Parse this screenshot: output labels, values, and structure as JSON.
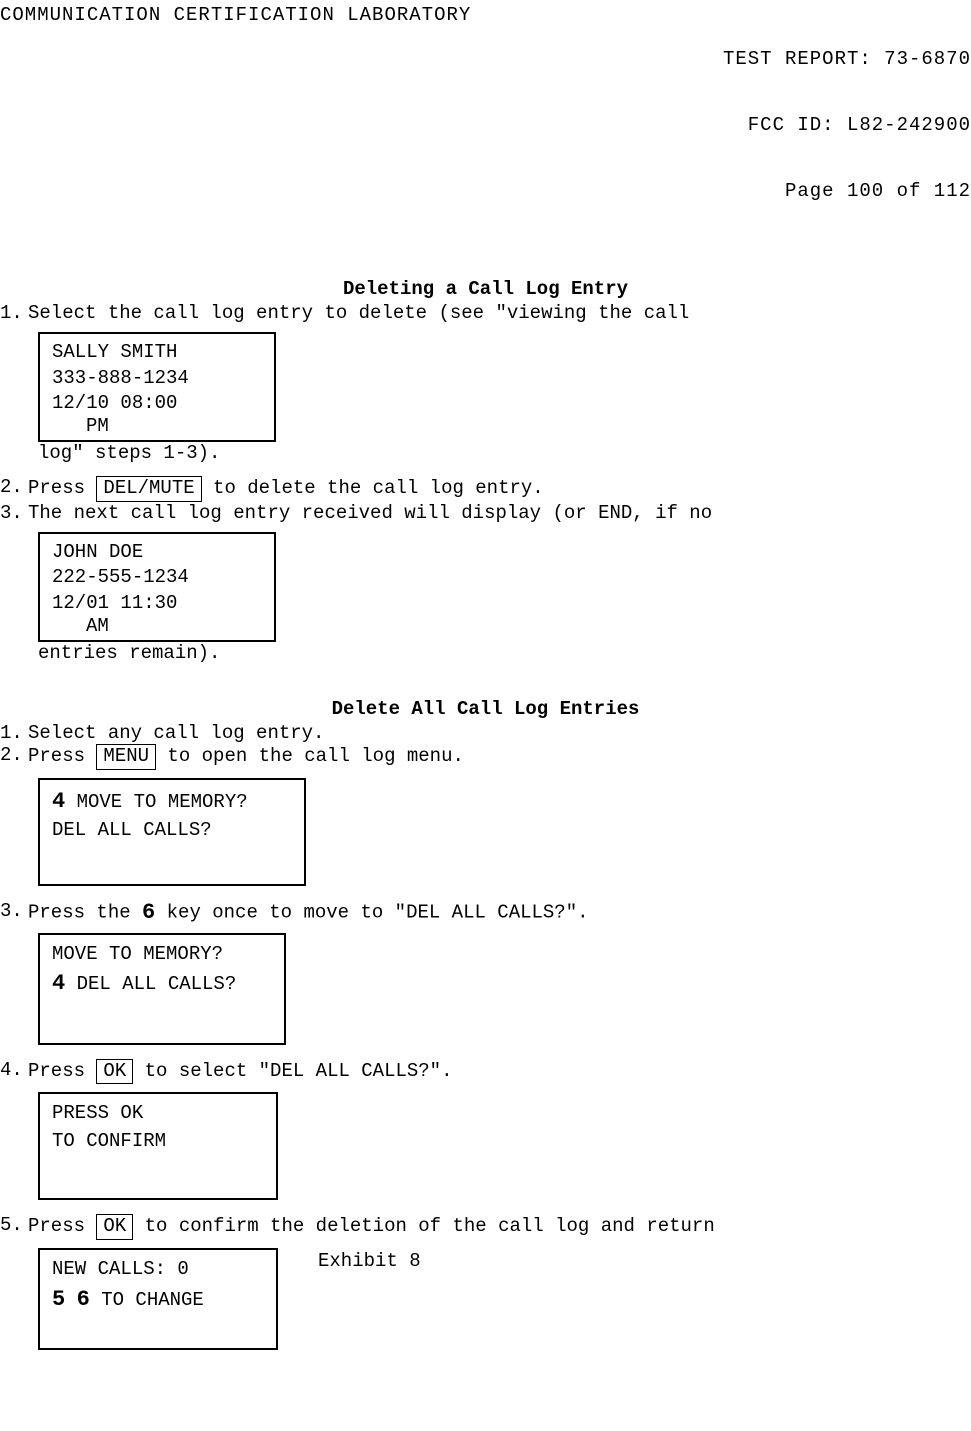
{
  "header": {
    "left": "COMMUNICATION CERTIFICATION LABORATORY",
    "right_line1": "TEST REPORT: 73-6870",
    "right_line2": "FCC ID: L82-242900",
    "right_line3": "Page 100 of 112"
  },
  "section1": {
    "title": "Deleting a Call Log Entry",
    "step1_num": "1.",
    "step1_text_a": "Select the call log entry to delete (see \"viewing the call",
    "step1_text_b": "log\" steps 1-3).",
    "display1": {
      "line1": "SALLY SMITH",
      "line2": "333-888-1234",
      "line3": "12/10   08:00",
      "line4": "PM"
    },
    "step2_num": "2.",
    "step2_text_a": "Press ",
    "step2_key": "DEL/MUTE",
    "step2_text_b": " to delete the call log entry.",
    "step3_num": "3.",
    "step3_text_a": "The next call log entry received will display (or END, if no",
    "step3_text_b": "entries remain).",
    "display2": {
      "line1": "JOHN DOE",
      "line2": "222-555-1234",
      "line3": "12/01   11:30",
      "line4": "AM"
    }
  },
  "section2": {
    "title": "Delete All Call Log Entries",
    "step1_num": "1.",
    "step1_text": "Select any call log entry.",
    "step2_num": "2.",
    "step2_text_a": "Press ",
    "step2_key": "MENU",
    "step2_text_b": " to open the call log menu.",
    "display3": {
      "arrow": "4",
      "line1": " MOVE TO MEMORY?",
      "line2": "DEL ALL CALLS?"
    },
    "step3_num": "3.",
    "step3_text_a": "Press the ",
    "step3_arrow": "6",
    "step3_text_b": " key once to move to \"DEL ALL CALLS?\".",
    "display4": {
      "line1": "MOVE TO MEMORY?",
      "arrow": "4",
      "line2": " DEL ALL CALLS?"
    },
    "step4_num": "4.",
    "step4_text_a": "Press ",
    "step4_key": "OK",
    "step4_text_b": " to select \"DEL ALL CALLS?\".",
    "display5": {
      "line1": "PRESS OK",
      "line2": "TO CONFIRM"
    },
    "step5_num": "5.",
    "step5_text_a": "Press ",
    "step5_key": "OK",
    "step5_text_b": " to confirm the deletion of the call log and return",
    "display6": {
      "line1": "NEW CALLS: 0",
      "arrow1": "5",
      "arrow2": "6",
      "line2": " TO CHANGE"
    },
    "exhibit": "Exhibit 8"
  }
}
